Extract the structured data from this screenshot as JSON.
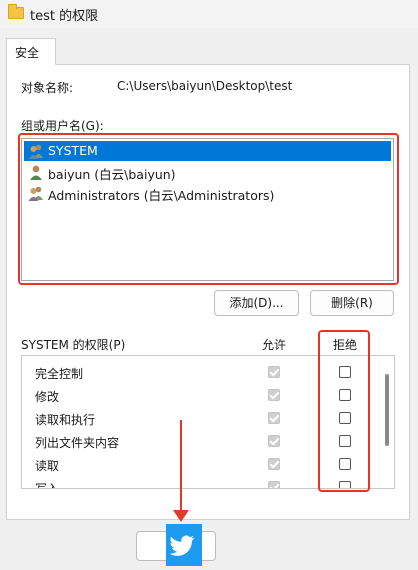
{
  "window": {
    "title": "test 的权限"
  },
  "tab": {
    "label": "安全"
  },
  "object": {
    "label": "对象名称:",
    "value": "C:\\Users\\baiyun\\Desktop\\test"
  },
  "groups": {
    "label": "组或用户名(G):",
    "items": [
      {
        "name": "SYSTEM",
        "selected": true,
        "icon": "group-users-icon"
      },
      {
        "name": "baiyun (白云\\baiyun)",
        "selected": false,
        "icon": "user-icon"
      },
      {
        "name": "Administrators (白云\\Administrators)",
        "selected": false,
        "icon": "group-users-icon"
      }
    ]
  },
  "buttons": {
    "add": "添加(D)...",
    "remove": "删除(R)"
  },
  "permissions": {
    "title": "SYSTEM 的权限(P)",
    "allow_header": "允许",
    "deny_header": "拒绝",
    "rows": [
      {
        "name": "完全控制",
        "allow": true,
        "deny": false
      },
      {
        "name": "修改",
        "allow": true,
        "deny": false
      },
      {
        "name": "读取和执行",
        "allow": true,
        "deny": false
      },
      {
        "name": "列出文件夹内容",
        "allow": true,
        "deny": false
      },
      {
        "name": "读取",
        "allow": true,
        "deny": false
      },
      {
        "name": "写入",
        "allow": true,
        "deny": false
      }
    ]
  },
  "colors": {
    "selection": "#0078d7",
    "highlight": "#e8322e",
    "overlay_bird": "#1d9bf0"
  }
}
